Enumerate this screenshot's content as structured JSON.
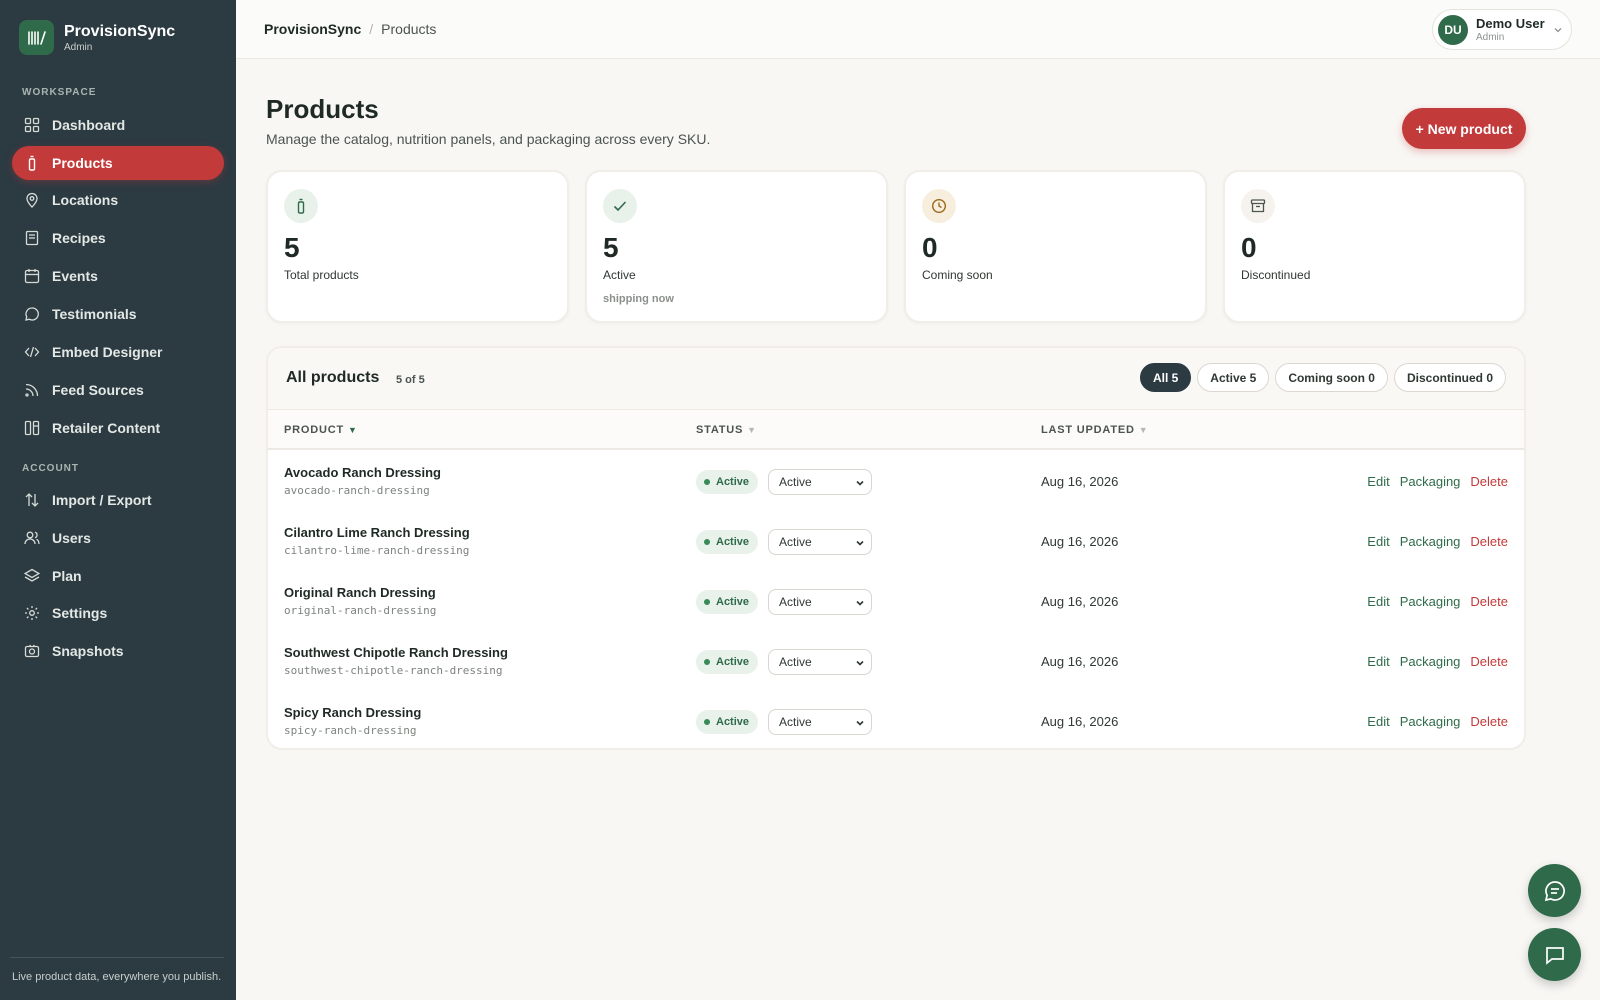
{
  "app": {
    "name": "ProvisionSync",
    "role": "Admin"
  },
  "sidebar": {
    "workspace_label": "WORKSPACE",
    "account_label": "ACCOUNT",
    "workspace_items": [
      {
        "label": "Dashboard",
        "icon": "grid-icon"
      },
      {
        "label": "Products",
        "icon": "bottle-icon",
        "active": true
      },
      {
        "label": "Locations",
        "icon": "map-pin-icon"
      },
      {
        "label": "Recipes",
        "icon": "book-icon"
      },
      {
        "label": "Events",
        "icon": "calendar-icon"
      },
      {
        "label": "Testimonials",
        "icon": "chat-bubble-icon"
      },
      {
        "label": "Embed Designer",
        "icon": "code-icon"
      },
      {
        "label": "Feed Sources",
        "icon": "rss-icon"
      },
      {
        "label": "Retailer Content",
        "icon": "columns-icon"
      }
    ],
    "account_items": [
      {
        "label": "Import / Export",
        "icon": "swap-icon"
      },
      {
        "label": "Users",
        "icon": "users-icon"
      },
      {
        "label": "Plan",
        "icon": "layers-icon"
      },
      {
        "label": "Settings",
        "icon": "gear-icon"
      },
      {
        "label": "Snapshots",
        "icon": "camera-icon"
      }
    ],
    "footer": "Live product data, everywhere you publish."
  },
  "topbar": {
    "breadcrumb_root": "ProvisionSync",
    "breadcrumb_sep": "/",
    "breadcrumb_current": "Products",
    "user": {
      "initials": "DU",
      "name": "Demo User",
      "role": "Admin"
    }
  },
  "page": {
    "title": "Products",
    "subtitle": "Manage the catalog, nutrition panels, and packaging across every SKU.",
    "new_button": "+ New product"
  },
  "stats": [
    {
      "value": "5",
      "label": "Total products",
      "note": "",
      "icon": "bottle-icon"
    },
    {
      "value": "5",
      "label": "Active",
      "note": "shipping now",
      "icon": "check-icon"
    },
    {
      "value": "0",
      "label": "Coming soon",
      "note": "",
      "icon": "clock-icon"
    },
    {
      "value": "0",
      "label": "Discontinued",
      "note": "",
      "icon": "archive-icon"
    }
  ],
  "table": {
    "title": "All products",
    "count": "5 of 5",
    "filters": [
      "All 5",
      "Active 5",
      "Coming soon 0",
      "Discontinued 0"
    ],
    "columns": {
      "product": "PRODUCT",
      "status": "STATUS",
      "updated": "LAST UPDATED"
    },
    "sort_arrow": "▼",
    "actions": {
      "edit": "Edit",
      "packaging": "Packaging",
      "delete": "Delete"
    },
    "rows": [
      {
        "name": "Avocado Ranch Dressing",
        "slug": "avocado-ranch-dressing",
        "status": "Active",
        "select": "Active",
        "updated": "Aug 16, 2026"
      },
      {
        "name": "Cilantro Lime Ranch Dressing",
        "slug": "cilantro-lime-ranch-dressing",
        "status": "Active",
        "select": "Active",
        "updated": "Aug 16, 2026"
      },
      {
        "name": "Original Ranch Dressing",
        "slug": "original-ranch-dressing",
        "status": "Active",
        "select": "Active",
        "updated": "Aug 16, 2026"
      },
      {
        "name": "Southwest Chipotle Ranch Dressing",
        "slug": "southwest-chipotle-ranch-dressing",
        "status": "Active",
        "select": "Active",
        "updated": "Aug 16, 2026"
      },
      {
        "name": "Spicy Ranch Dressing",
        "slug": "spicy-ranch-dressing",
        "status": "Active",
        "select": "Active",
        "updated": "Aug 16, 2026"
      }
    ]
  },
  "colors": {
    "sidebar": "#2c3a42",
    "accent_red": "#c33a3a",
    "brand_green": "#2f6b4a"
  }
}
